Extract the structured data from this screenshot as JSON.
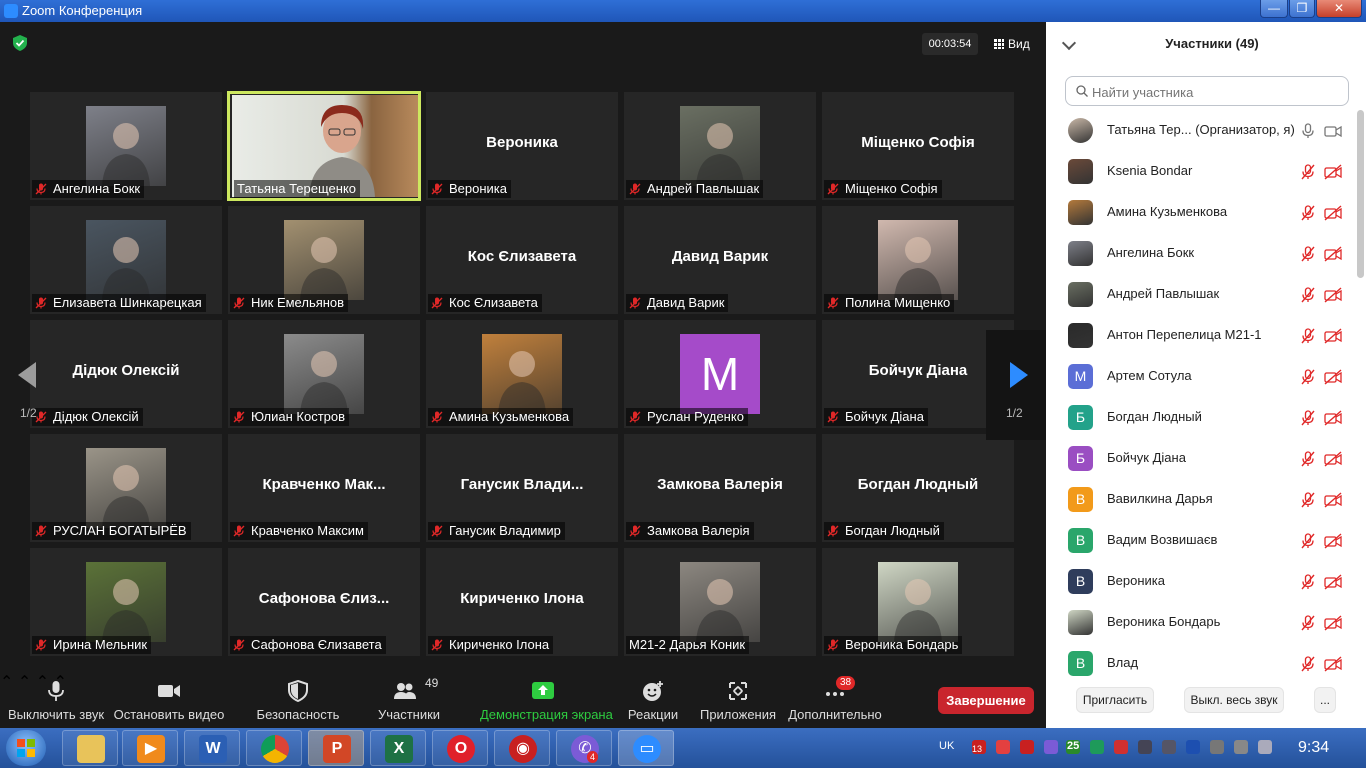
{
  "window": {
    "title": "Zoom Конференция"
  },
  "meeting": {
    "timer": "00:03:54",
    "view_label": "Вид",
    "page_left": "1/2",
    "page_right": "1/2"
  },
  "tiles": [
    {
      "name": "Ангелина Бокк",
      "photo": "#7e8089"
    },
    {
      "name": "Татьяна Терещенко",
      "active": true
    },
    {
      "name": "Вероника",
      "big": "Вероника"
    },
    {
      "name": "Андрей Павлышак",
      "photo": "#6a6f62"
    },
    {
      "name": "Міщенко Софія",
      "big": "Міщенко Софія"
    },
    {
      "name": "Елизавета Шинкарецкая",
      "photo": "#4a5560"
    },
    {
      "name": "Ник Емельянов",
      "photo": "#a29070"
    },
    {
      "name": "Кос  Єлизавета",
      "big": "Кос  Єлизавета"
    },
    {
      "name": "Давид Варик",
      "big": "Давид Варик"
    },
    {
      "name": "Полина Мищенко",
      "photo": "#d0b8ae"
    },
    {
      "name": "Дідюк Олексій",
      "big": "Дідюк Олексій"
    },
    {
      "name": "Юлиан Костров",
      "photo": "#8b8b8b"
    },
    {
      "name": "Амина Кузьменкова",
      "photo": "#c0803c"
    },
    {
      "name": "Руслан Руденко",
      "letter": "M",
      "letter_color": "#a54bc9"
    },
    {
      "name": "Бойчук Діана",
      "big": "Бойчук Діана"
    },
    {
      "name": "РУСЛАН БОГАТЫРЁВ",
      "photo": "#9a9488"
    },
    {
      "name": "Кравченко Максим",
      "big": "Кравченко  Мак..."
    },
    {
      "name": "Ганусик Владимир",
      "big": "Ганусик  Влади..."
    },
    {
      "name": "Замкова Валерія",
      "big": "Замкова Валерія"
    },
    {
      "name": "Богдан Людный",
      "big": "Богдан Людный"
    },
    {
      "name": "Ирина Мельник",
      "photo": "#5b7238"
    },
    {
      "name": "Сафонова Єлизавета",
      "big": "Сафонова Єлиз..."
    },
    {
      "name": "Кириченко Ілона",
      "big": "Кириченко Ілона"
    },
    {
      "name": "М21-2 Дарья Коник",
      "photo": "#8c8780",
      "nomic": true
    },
    {
      "name": "Вероника Бондарь",
      "photo": "#cfd6c4"
    }
  ],
  "toolbar": {
    "mute": "Выключить звук",
    "video": "Остановить видео",
    "security": "Безопасность",
    "participants": "Участники",
    "participants_count": "49",
    "share": "Демонстрация экрана",
    "reactions": "Реакции",
    "apps": "Приложения",
    "more": "Дополнительно",
    "more_badge": "38",
    "end": "Завершение"
  },
  "panel": {
    "title": "Участники (49)",
    "search_placeholder": "Найти участника",
    "participants": [
      {
        "name": "Татьяна Тер...  (Организатор, я)",
        "avatar_color": "#c9b8a8",
        "photo": true,
        "host": true
      },
      {
        "name": "Ksenia Bondar",
        "avatar_color": "#6b4a3a",
        "photo": true
      },
      {
        "name": "Амина Кузьменкова",
        "avatar_color": "#b47a3c",
        "photo": true
      },
      {
        "name": "Ангелина Бокк",
        "avatar_color": "#7e8089",
        "photo": true
      },
      {
        "name": "Андрей Павлышак",
        "avatar_color": "#6a6f62",
        "photo": true
      },
      {
        "name": "Антон Перепелица М21-1",
        "avatar_color": "#2a2a2a",
        "photo": true
      },
      {
        "name": "Артем Сотула",
        "avatar_color": "#5b6ed6",
        "letter": "M"
      },
      {
        "name": "Богдан Людный",
        "avatar_color": "#23a28a",
        "letter": "Б"
      },
      {
        "name": "Бойчук Діана",
        "avatar_color": "#9a4ec2",
        "letter": "Б"
      },
      {
        "name": "Вавилкина Дарья",
        "avatar_color": "#f29a1a",
        "letter": "В"
      },
      {
        "name": "Вадим Возвишаєв",
        "avatar_color": "#2aa66b",
        "letter": "В"
      },
      {
        "name": "Вероника",
        "avatar_color": "#2f3d5c",
        "letter": "В"
      },
      {
        "name": "Вероника Бондарь",
        "avatar_color": "#cfd6c4",
        "photo": true
      },
      {
        "name": "Влад",
        "avatar_color": "#2aa66b",
        "letter": "В"
      }
    ],
    "invite": "Пригласить",
    "mute_all": "Выкл. весь звук",
    "more": "..."
  },
  "taskbar": {
    "lang": "UK",
    "clock": "9:34",
    "viber_badge": "4",
    "tray_badge_1": "13",
    "tray_badge_2": "25"
  },
  "colors": {
    "accent": "#2d8cff",
    "end": "#c9252d",
    "share": "#2ecc40",
    "muted": "#e02828",
    "active_speaker": "#cde85f"
  }
}
